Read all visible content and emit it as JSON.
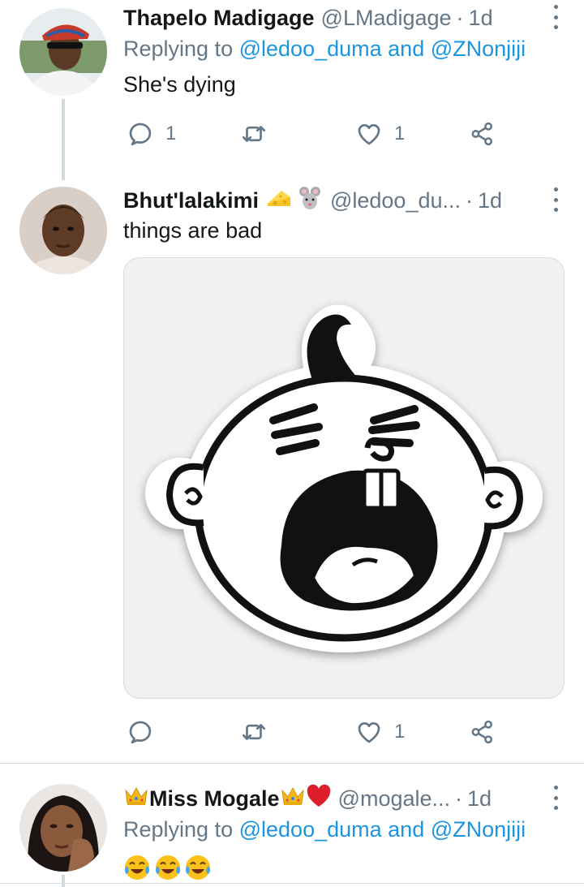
{
  "tweets": [
    {
      "name": "Thapelo Madigage",
      "handle": "@LMadigage",
      "dot": "·",
      "time": "1d",
      "reply_prefix": "Replying to",
      "reply_mention_1": "@ledoo_duma",
      "reply_and": "and",
      "reply_mention_2": "@ZNonjiji",
      "text": "She's dying",
      "reply_count": "1",
      "retweet_count": "",
      "like_count": "1"
    },
    {
      "name": "Bhut'lalakimi",
      "name_emojis": [
        "cheese-emoji",
        "mouse-emoji"
      ],
      "handle": "@ledoo_du...",
      "dot": "·",
      "time": "1d",
      "text": "things are bad",
      "reply_count": "",
      "retweet_count": "",
      "like_count": "1"
    },
    {
      "name": "Miss Mogale",
      "name_emojis": [
        "crown-emoji",
        "crown-emoji",
        "red-heart-emoji"
      ],
      "handle": "@mogale...",
      "dot": "·",
      "time": "1d",
      "reply_prefix": "Replying to",
      "reply_mention_1": "@ledoo_duma",
      "reply_and": "and",
      "reply_mention_2": "@ZNonjiji",
      "text_emojis": [
        "tears-of-joy-emoji",
        "tears-of-joy-emoji",
        "tears-of-joy-emoji"
      ]
    }
  ],
  "colors": {
    "link": "#1b95e0",
    "secondary": "#657786",
    "divider": "#d6dde2"
  }
}
